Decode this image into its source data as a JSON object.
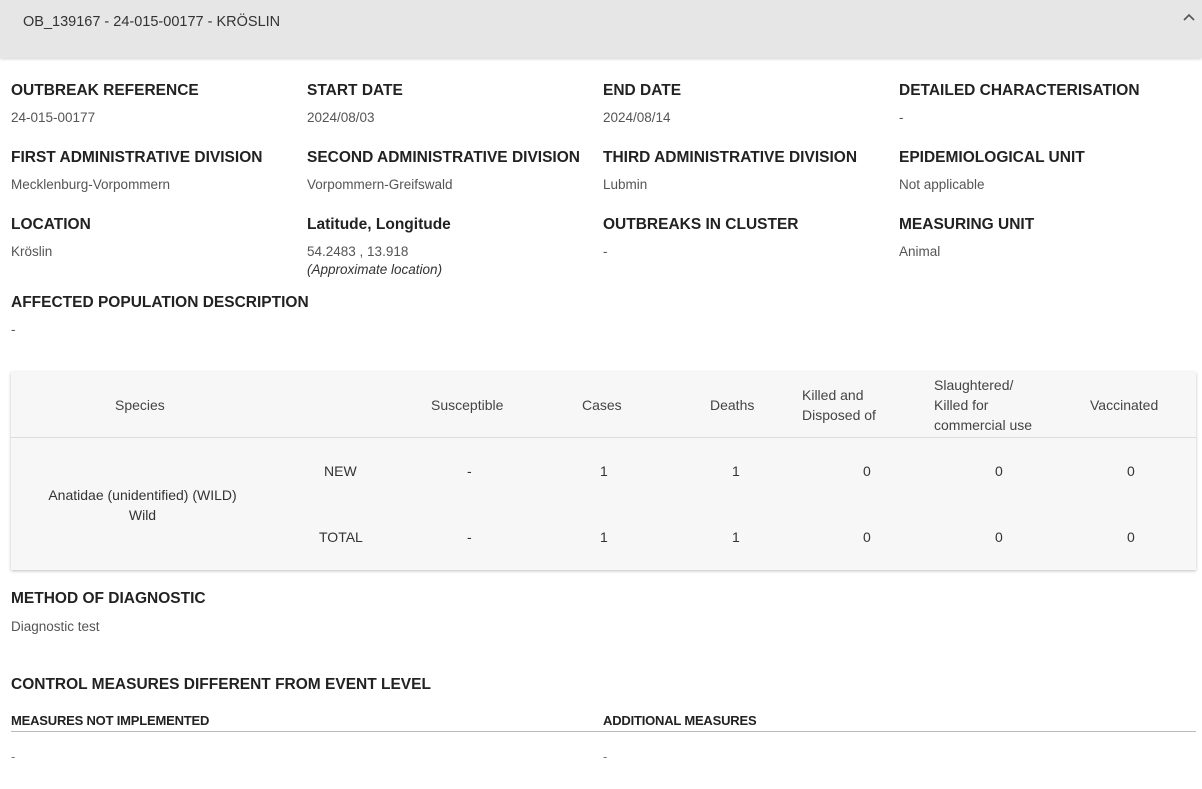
{
  "header": {
    "title": "OB_139167 - 24-015-00177 - KRÖSLIN",
    "collapse_icon": "chevron-up-icon"
  },
  "fields": {
    "outbreak_reference": {
      "label": "OUTBREAK REFERENCE",
      "value": "24-015-00177"
    },
    "start_date": {
      "label": "START DATE",
      "value": "2024/08/03"
    },
    "end_date": {
      "label": "END DATE",
      "value": "2024/08/14"
    },
    "detailed_characterisation": {
      "label": "DETAILED CHARACTERISATION",
      "value": "-"
    },
    "first_admin": {
      "label": "FIRST ADMINISTRATIVE DIVISION",
      "value": "Mecklenburg-Vorpommern"
    },
    "second_admin": {
      "label": "SECOND ADMINISTRATIVE DIVISION",
      "value": "Vorpommern-Greifswald"
    },
    "third_admin": {
      "label": "THIRD ADMINISTRATIVE DIVISION",
      "value": "Lubmin"
    },
    "epi_unit": {
      "label": "EPIDEMIOLOGICAL UNIT",
      "value": "Not applicable"
    },
    "location": {
      "label": "LOCATION",
      "value": "Kröslin"
    },
    "lat_long": {
      "label": "Latitude, Longitude",
      "value": "54.2483 , 13.918",
      "note": "(Approximate location)"
    },
    "outbreaks_cluster": {
      "label": "OUTBREAKS IN CLUSTER",
      "value": "-"
    },
    "measuring_unit": {
      "label": "MEASURING UNIT",
      "value": "Animal"
    },
    "affected_population": {
      "label": "AFFECTED POPULATION DESCRIPTION",
      "value": "-"
    }
  },
  "table": {
    "headers": {
      "species": "Species",
      "susceptible": "Susceptible",
      "cases": "Cases",
      "deaths": "Deaths",
      "killed_1": "Killed and",
      "killed_2": "Disposed of",
      "slaughtered_1": "Slaughtered/",
      "slaughtered_2": "Killed for",
      "slaughtered_3": "commercial use",
      "vaccinated": "Vaccinated"
    },
    "species_line1": "Anatidae (unidentified) (WILD)",
    "species_line2": "Wild",
    "rows": [
      {
        "type": "NEW",
        "susceptible": "-",
        "cases": "1",
        "deaths": "1",
        "killed": "0",
        "slaughtered": "0",
        "vaccinated": "0"
      },
      {
        "type": "TOTAL",
        "susceptible": "-",
        "cases": "1",
        "deaths": "1",
        "killed": "0",
        "slaughtered": "0",
        "vaccinated": "0"
      }
    ]
  },
  "method": {
    "label": "METHOD OF DIAGNOSTIC",
    "value": "Diagnostic test"
  },
  "control": {
    "title": "CONTROL MEASURES DIFFERENT FROM EVENT LEVEL",
    "not_implemented_label": "MEASURES NOT IMPLEMENTED",
    "not_implemented_value": "-",
    "additional_label": "ADDITIONAL MEASURES",
    "additional_value": "-"
  }
}
